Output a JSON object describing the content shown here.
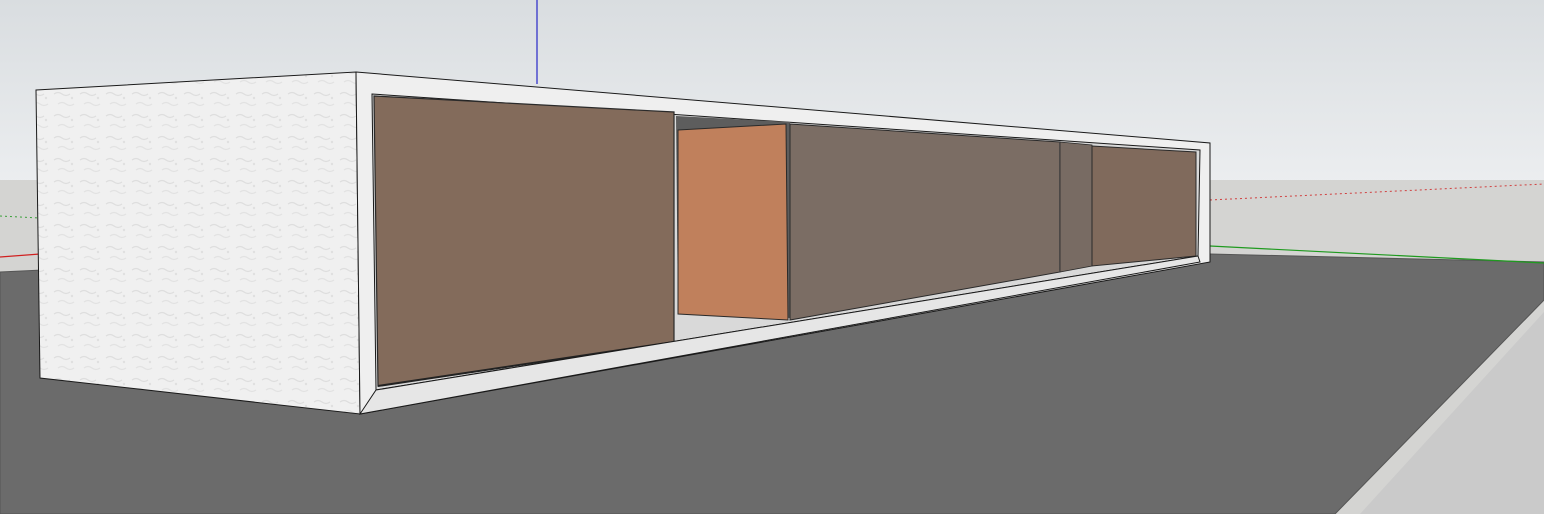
{
  "app": {
    "type": "3d-modeling-viewport"
  },
  "scene": {
    "colors": {
      "sky_top": "#dde0e3",
      "sky_horizon": "#eef0f1",
      "ground_far": "#d3d3d1",
      "ground_plane": "#6b6b6b",
      "ground_edge": "#c8c8c8",
      "wall_white": "#efefef",
      "wall_shadow": "#e3e3e3",
      "glass_brown": "#836b5b",
      "glass_grey": "#7b6d64",
      "door_orange": "#c0805c",
      "axis_red": "#d02020",
      "axis_green": "#1f9a1f",
      "axis_blue": "#2020c8",
      "edge_black": "#1a1a1a"
    },
    "axes": {
      "red_label": "red-axis",
      "green_label": "green-axis",
      "blue_label": "blue-axis"
    },
    "objects": [
      "building-box",
      "left-end-wall",
      "front-glass-panel",
      "orange-door-panel",
      "rear-glass-panel",
      "back-glass-panel",
      "ground-plane"
    ]
  }
}
